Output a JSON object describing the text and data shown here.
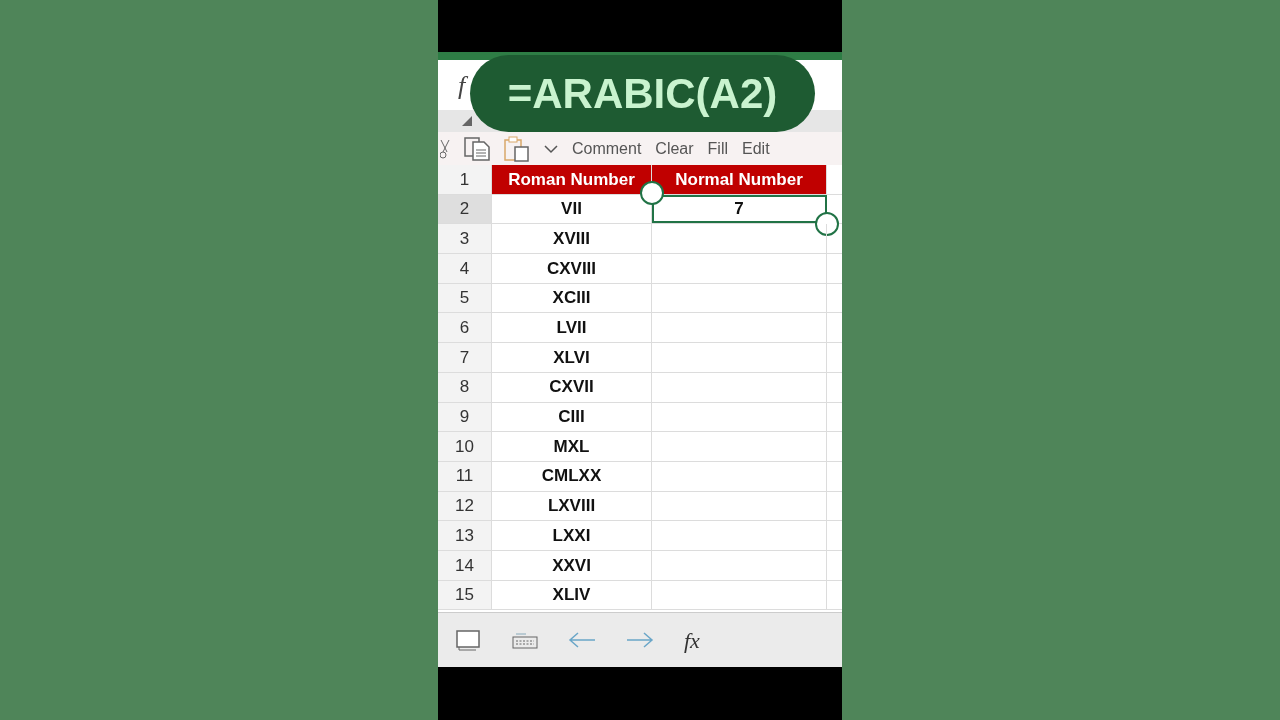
{
  "formula_overlay": "=ARABIC(A2)",
  "formula_bar": {
    "label": "f"
  },
  "context_menu": {
    "items": [
      "Comment",
      "Clear",
      "Fill",
      "Edit"
    ]
  },
  "sheet": {
    "header_row": "1",
    "columns": [
      {
        "header": "Roman Number"
      },
      {
        "header": "Normal Number"
      }
    ],
    "rows": [
      {
        "number": "2",
        "cells": [
          {
            "value": "VII",
            "selected": false
          },
          {
            "value": "7",
            "selected": true
          }
        ]
      },
      {
        "number": "3",
        "cells": [
          {
            "value": "XVIII",
            "selected": false
          },
          {
            "selected": false
          }
        ]
      },
      {
        "number": "4",
        "cells": [
          {
            "value": "CXVIII",
            "selected": false
          },
          {
            "selected": false
          }
        ]
      },
      {
        "number": "5",
        "cells": [
          {
            "value": "XCIII",
            "selected": false
          },
          {
            "selected": false
          }
        ]
      },
      {
        "number": "6",
        "cells": [
          {
            "value": "LVII",
            "selected": false
          },
          {
            "selected": false
          }
        ]
      },
      {
        "number": "7",
        "cells": [
          {
            "value": "XLVI",
            "selected": false
          },
          {
            "selected": false
          }
        ]
      },
      {
        "number": "8",
        "cells": [
          {
            "value": "CXVII",
            "selected": false
          },
          {
            "selected": false
          }
        ]
      },
      {
        "number": "9",
        "cells": [
          {
            "value": "CIII",
            "selected": false
          },
          {
            "selected": false
          }
        ]
      },
      {
        "number": "10",
        "cells": [
          {
            "value": "MXL",
            "selected": false
          },
          {
            "selected": false
          }
        ]
      },
      {
        "number": "11",
        "cells": [
          {
            "value": "CMLXX",
            "selected": false
          },
          {
            "selected": false
          }
        ]
      },
      {
        "number": "12",
        "cells": [
          {
            "value": "LXVIII",
            "selected": false
          },
          {
            "selected": false
          }
        ]
      },
      {
        "number": "13",
        "cells": [
          {
            "value": "LXXI",
            "selected": false
          },
          {
            "selected": false
          }
        ]
      },
      {
        "number": "14",
        "cells": [
          {
            "value": "XXVI",
            "selected": false
          },
          {
            "selected": false
          }
        ]
      },
      {
        "number": "15",
        "cells": [
          {
            "value": "XLIV",
            "selected": false
          },
          {
            "selected": false
          }
        ]
      }
    ]
  },
  "bottom_toolbar": {
    "function_label": "fx"
  }
}
